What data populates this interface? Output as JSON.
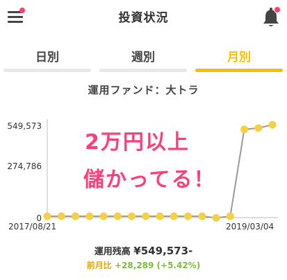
{
  "header": {
    "title": "投資状況",
    "menu_icon": "menu-icon",
    "bell_icon": "bell-icon",
    "notification_color": "#ff3e6b"
  },
  "tabs": [
    {
      "label": "日別",
      "active": false
    },
    {
      "label": "週別",
      "active": false
    },
    {
      "label": "月別",
      "active": true
    }
  ],
  "accent_color": "#f2c200",
  "fund_label": "運用ファンド：大トラ",
  "overlay": {
    "line1": "2万円以上",
    "line2": "儲かってる！",
    "color": "#ff3e79"
  },
  "chart_data": {
    "type": "line",
    "title": "",
    "xlabel": "",
    "ylabel": "",
    "y_ticks": [
      "549,573",
      "274,786",
      "0"
    ],
    "x_tick_labels": [
      "2017/08/21",
      "2019/03/04"
    ],
    "ylim": [
      0,
      549573
    ],
    "grid": false,
    "series": [
      {
        "values": [
          0,
          0,
          0,
          0,
          0,
          0,
          0,
          0,
          0,
          0,
          0,
          0,
          -10000,
          0,
          521284,
          530000,
          549573
        ]
      }
    ],
    "point_color": "#f5d142",
    "line_color": "#999999"
  },
  "summary": {
    "balance_label": "運用残高",
    "balance_value": "¥549,573-",
    "change_label": "前月比",
    "change_value": "+28,289 (+5.42%)"
  }
}
